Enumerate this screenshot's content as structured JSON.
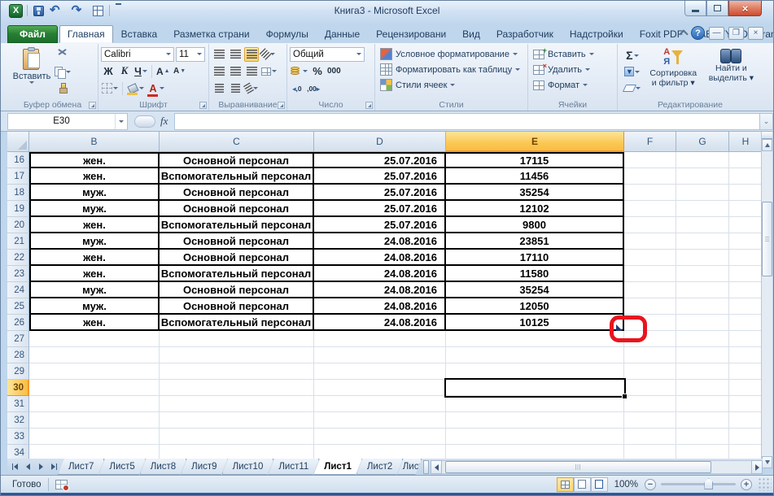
{
  "window": {
    "title": "Книга3  -  Microsoft Excel"
  },
  "qat": {
    "icons": [
      "excel-logo",
      "save",
      "undo",
      "redo",
      "quick-table",
      "customize-toolbar"
    ],
    "undo_glyph": "↶",
    "redo_glyph": "↷"
  },
  "tab_strip": {
    "tabs": [
      {
        "label": "Файл",
        "type": "file"
      },
      {
        "label": "Главная",
        "active": true
      },
      {
        "label": "Вставка"
      },
      {
        "label": "Разметка страни"
      },
      {
        "label": "Формулы"
      },
      {
        "label": "Данные"
      },
      {
        "label": "Рецензировани"
      },
      {
        "label": "Вид"
      },
      {
        "label": "Разработчик"
      },
      {
        "label": "Надстройки"
      },
      {
        "label": "Foxit PDF"
      },
      {
        "label": "ABBYY PDF Transf"
      }
    ],
    "help_glyph": "?"
  },
  "ribbon": {
    "clipboard": {
      "group_label": "Буфер обмена",
      "paste_label": "Вставить"
    },
    "font": {
      "group_label": "Шрифт",
      "font_name": "Calibri",
      "font_size": "11",
      "bold": "Ж",
      "italic": "К",
      "underline": "Ч",
      "grow": "А",
      "shrink": "А",
      "color_letter": "А"
    },
    "alignment": {
      "group_label": "Выравнивание"
    },
    "number": {
      "group_label": "Число",
      "format": "Общий",
      "percent": "%",
      "thousands": "000",
      "dec_inc": ",0",
      "dec_dec": ",00"
    },
    "styles": {
      "group_label": "Стили",
      "items": [
        "Условное форматирование",
        "Форматировать как таблицу",
        "Стили ячеек"
      ]
    },
    "cells": {
      "group_label": "Ячейки",
      "items": [
        "Вставить",
        "Удалить",
        "Формат"
      ]
    },
    "editing": {
      "group_label": "Редактирование",
      "autosum": "Σ",
      "sort_line1": "Сортировка",
      "sort_line2": "и фильтр",
      "find_line1": "Найти и",
      "find_line2": "выделить"
    }
  },
  "formula_bar": {
    "name_box": "E30",
    "fx": "fx",
    "value": ""
  },
  "grid": {
    "columns": [
      "B",
      "C",
      "D",
      "E",
      "F",
      "G",
      "H"
    ],
    "active_column": "E",
    "rows_start": 16,
    "rows_end": 34,
    "active_row": 30,
    "selected_cell": "E30",
    "data_rows": [
      {
        "row": 16,
        "B": "жен.",
        "C": "Основной персонал",
        "D": "25.07.2016",
        "E": "17115"
      },
      {
        "row": 17,
        "B": "жен.",
        "C": "Вспомогательный персонал",
        "D": "25.07.2016",
        "E": "11456"
      },
      {
        "row": 18,
        "B": "муж.",
        "C": "Основной персонал",
        "D": "25.07.2016",
        "E": "35254"
      },
      {
        "row": 19,
        "B": "муж.",
        "C": "Основной персонал",
        "D": "25.07.2016",
        "E": "12102"
      },
      {
        "row": 20,
        "B": "жен.",
        "C": "Вспомогательный персонал",
        "D": "25.07.2016",
        "E": "9800"
      },
      {
        "row": 21,
        "B": "муж.",
        "C": "Основной персонал",
        "D": "24.08.2016",
        "E": "23851"
      },
      {
        "row": 22,
        "B": "жен.",
        "C": "Основной персонал",
        "D": "24.08.2016",
        "E": "17110"
      },
      {
        "row": 23,
        "B": "жен.",
        "C": "Вспомогательный персонал",
        "D": "24.08.2016",
        "E": "11580"
      },
      {
        "row": 24,
        "B": "муж.",
        "C": "Основной персонал",
        "D": "24.08.2016",
        "E": "35254"
      },
      {
        "row": 25,
        "B": "муж.",
        "C": "Основной персонал",
        "D": "24.08.2016",
        "E": "12050"
      },
      {
        "row": 26,
        "B": "жен.",
        "C": "Вспомогательный персонал",
        "D": "24.08.2016",
        "E": "10125"
      }
    ]
  },
  "annotation": {
    "type": "red-circle-highlight",
    "near_cell": "F26",
    "color": "#e9141f"
  },
  "sheet_tabs": {
    "tabs": [
      {
        "label": "Лист7"
      },
      {
        "label": "Лист5"
      },
      {
        "label": "Лист8"
      },
      {
        "label": "Лист9"
      },
      {
        "label": "Лист10"
      },
      {
        "label": "Лист11"
      },
      {
        "label": "Лист1",
        "active": true
      },
      {
        "label": "Лист2"
      },
      {
        "label": "Лист",
        "clipped": true
      }
    ]
  },
  "status_bar": {
    "mode": "Готово",
    "zoom": "100%"
  },
  "colors": {
    "selection_header": "#fbc853",
    "annotation_red": "#e9141f",
    "file_tab_green": "#267e33",
    "table_border": "#000000"
  }
}
